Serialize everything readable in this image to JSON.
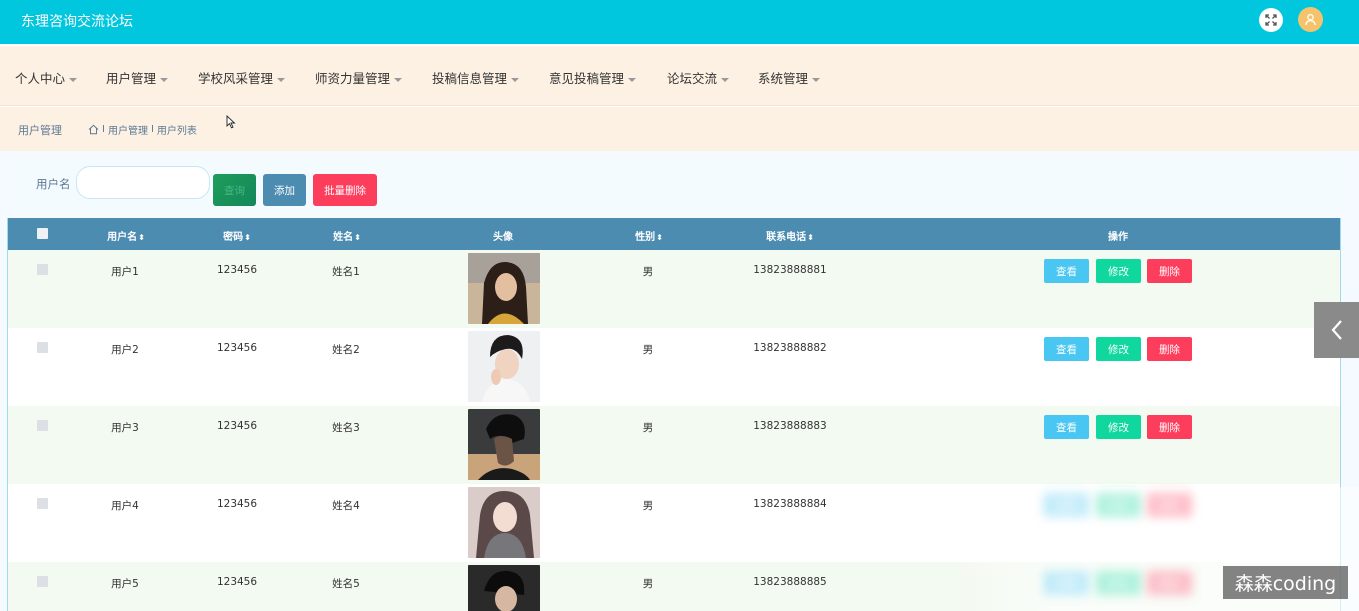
{
  "app": {
    "title": "东理咨询交流论坛"
  },
  "menu": [
    {
      "label": "个人中心"
    },
    {
      "label": "用户管理"
    },
    {
      "label": "学校风采管理"
    },
    {
      "label": "师资力量管理"
    },
    {
      "label": "投稿信息管理"
    },
    {
      "label": "意见投稿管理"
    },
    {
      "label": "论坛交流"
    },
    {
      "label": "系统管理"
    }
  ],
  "breadcrumb": {
    "section": "用户管理",
    "path": [
      "用户管理",
      "用户列表"
    ],
    "separator": "I"
  },
  "search": {
    "label": "用户名",
    "value": "",
    "placeholder": "",
    "search_button": "查询",
    "add_button": "添加",
    "bulk_delete_button": "批量删除"
  },
  "table": {
    "columns": [
      "用户名",
      "密码",
      "姓名",
      "头像",
      "性别",
      "联系电话",
      "操作"
    ],
    "sortable": [
      true,
      true,
      true,
      false,
      true,
      true,
      false
    ],
    "actions": {
      "view": "查看",
      "edit": "修改",
      "delete": "删除"
    },
    "rows": [
      {
        "username": "用户1",
        "password": "123456",
        "name": "姓名1",
        "gender": "男",
        "phone": "13823888881",
        "avatar": "woman-long-hair"
      },
      {
        "username": "用户2",
        "password": "123456",
        "name": "姓名2",
        "gender": "男",
        "phone": "13823888882",
        "avatar": "man-hand-chin"
      },
      {
        "username": "用户3",
        "password": "123456",
        "name": "姓名3",
        "gender": "男",
        "phone": "13823888883",
        "avatar": "man-profile-sunset"
      },
      {
        "username": "用户4",
        "password": "123456",
        "name": "姓名4",
        "gender": "男",
        "phone": "13823888884",
        "avatar": "woman-scarf"
      },
      {
        "username": "用户5",
        "password": "123456",
        "name": "姓名5",
        "gender": "男",
        "phone": "13823888885",
        "avatar": "man-dark"
      }
    ]
  },
  "watermark": "森森coding",
  "colors": {
    "topbar": "#00c6de",
    "menubar": "#fdf1e4",
    "table_header": "#4d8cb1",
    "view": "#49c6f2",
    "edit": "#0fd79d",
    "delete": "#fc3d5c"
  }
}
